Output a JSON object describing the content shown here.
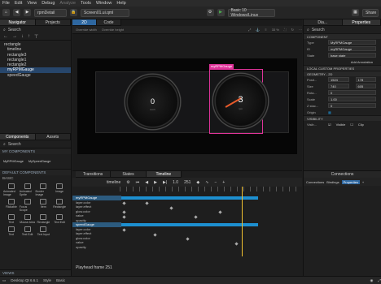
{
  "menu": [
    "File",
    "Edit",
    "View",
    "Debug",
    "Analyze",
    "Tools",
    "Window",
    "Help"
  ],
  "toolbar": {
    "back": "◀",
    "forward": "▶",
    "project": "rpmDetail",
    "file": "Screen01.ui.qml",
    "run": "▶",
    "device": "Basic 10 Windows/Linux",
    "share": "Share"
  },
  "navigator": {
    "tabs": [
      "Navigator",
      "Projects"
    ],
    "search": "Search",
    "items": [
      "rectangle",
      "timeline",
      "rectangle3",
      "rectangle1",
      "rectangle2",
      "myRPMGauge",
      "speedGauge"
    ],
    "selected_index": 5
  },
  "components": {
    "tabs": [
      "Components",
      "Assets"
    ],
    "search": "Search",
    "my_components_label": "MY COMPONENTS",
    "my_components": [
      "MyRPMGauge",
      "MySpeedGauge"
    ],
    "default_label": "DEFAULT COMPONENTS",
    "basic_label": "BASIC",
    "basic_items": [
      "Animated Image",
      "Animated Sprite",
      "Border Image",
      "Image",
      "Flickable",
      "Focus Scope",
      "Item",
      "Rectangle",
      "Text",
      "Mouse Area",
      "Rectangle",
      "Text Edit",
      "Text",
      "Text Edit",
      "Text Input"
    ],
    "views_label": "VIEWS"
  },
  "editor": {
    "tabs": [
      "2D",
      "Code"
    ],
    "override_width": "Override width",
    "override_height": "Override height",
    "zoom": "33 %",
    "selection_label": "myRPMGauge",
    "gauge_left_value": "0",
    "gauge_left_unit": "km/h",
    "gauge_right_value": "3",
    "gauge_right_unit": "rpm"
  },
  "bottom": {
    "tabs": [
      "Transitions",
      "States",
      "Timeline"
    ],
    "timeline_name": "timeline",
    "frame_start": "1.0",
    "frame_current": "251",
    "rows": [
      "myRPMGauge",
      "layer.color",
      "layer.effect",
      "glow.color",
      "value",
      "opacity",
      "speedGauge",
      "layer.color",
      "layer.effect",
      "glow.color",
      "value",
      "opacity"
    ],
    "header_rows": [
      0,
      6
    ],
    "playhead_label": "Playhead frame 251"
  },
  "right_panel": {
    "tabs": [
      "Dia...",
      "Properties"
    ],
    "search": "Search",
    "component_label": "COMPONENT",
    "type_label": "Type",
    "type_value": "MyRPMGauge",
    "id_label": "ID",
    "id_value": "myRPMGauge",
    "state_label": "State",
    "state_value": "base state",
    "add_annotation": "Add Annotation",
    "local_custom_label": "LOCAL CUSTOM PROPERTIES",
    "geometry_label": "GEOMETRY - 2D",
    "position_label": "Posit...",
    "pos_x": "1524",
    "pos_y": "178",
    "size_label": "Size",
    "width": "740",
    "height": "605",
    "rotation_label": "Rota...",
    "rotation": "0",
    "scale_label": "Scale",
    "scale": "1.00",
    "z_label": "Z stac...",
    "z": "0",
    "origin_label": "Origin",
    "visibility_label": "VISIBILITY",
    "visible_label": "Visib...",
    "visible_value": "Visible",
    "clip_label": "Clip",
    "connections_tabs": [
      "Connections",
      "Bindings",
      "Properties"
    ],
    "connections_title": "Connections"
  },
  "status": {
    "kit": "Desktop Qt 6.6.1",
    "style": "Style",
    "style_value": "Basic"
  },
  "colors": {
    "accent": "#1d8fd0",
    "selection": "#e0339a"
  }
}
